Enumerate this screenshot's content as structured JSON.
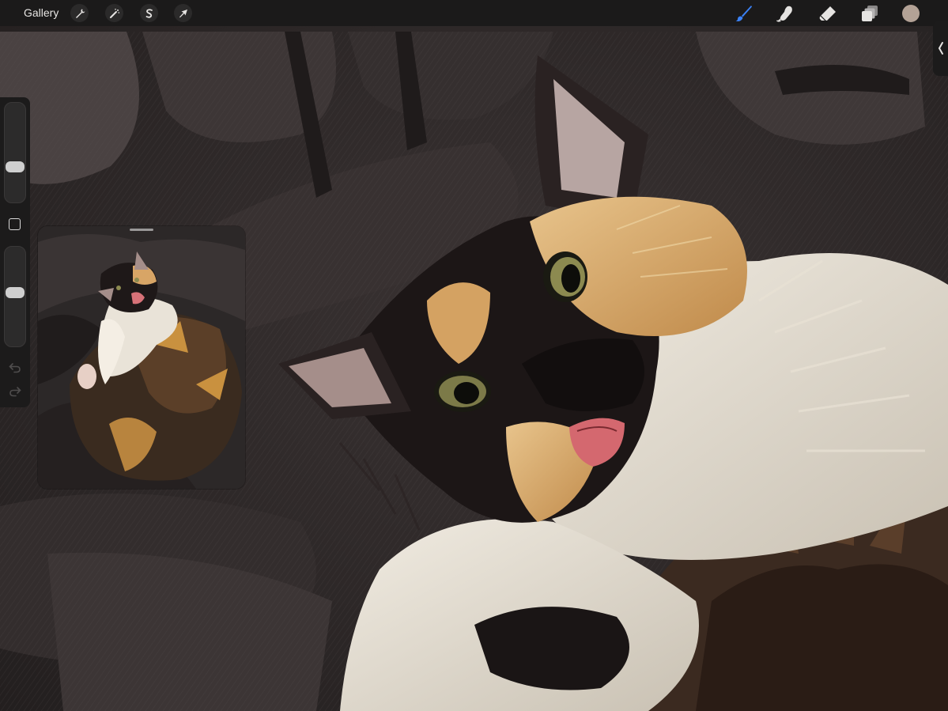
{
  "toolbar": {
    "gallery_label": "Gallery",
    "left_tools": [
      {
        "name": "actions",
        "icon": "wrench-icon"
      },
      {
        "name": "adjustments",
        "icon": "magic-wand-icon"
      },
      {
        "name": "selection",
        "icon": "selection-s-icon"
      },
      {
        "name": "transform",
        "icon": "arrow-cursor-icon"
      }
    ],
    "right_tools": [
      {
        "name": "brush",
        "icon": "brush-icon",
        "active": true
      },
      {
        "name": "smudge",
        "icon": "smudge-finger-icon",
        "active": false
      },
      {
        "name": "eraser",
        "icon": "eraser-icon",
        "active": false
      },
      {
        "name": "layers",
        "icon": "layers-icon",
        "active": false
      }
    ],
    "current_color": "#b3a296",
    "accent_color": "#3b82f6"
  },
  "sidebar": {
    "brush_size_level": 0.36,
    "opacity_level": 0.43
  },
  "reference_window": {
    "visible": true,
    "content": "calico-cat-illustration-thumbnail"
  },
  "canvas": {
    "content": "calico-cat-illustration"
  }
}
